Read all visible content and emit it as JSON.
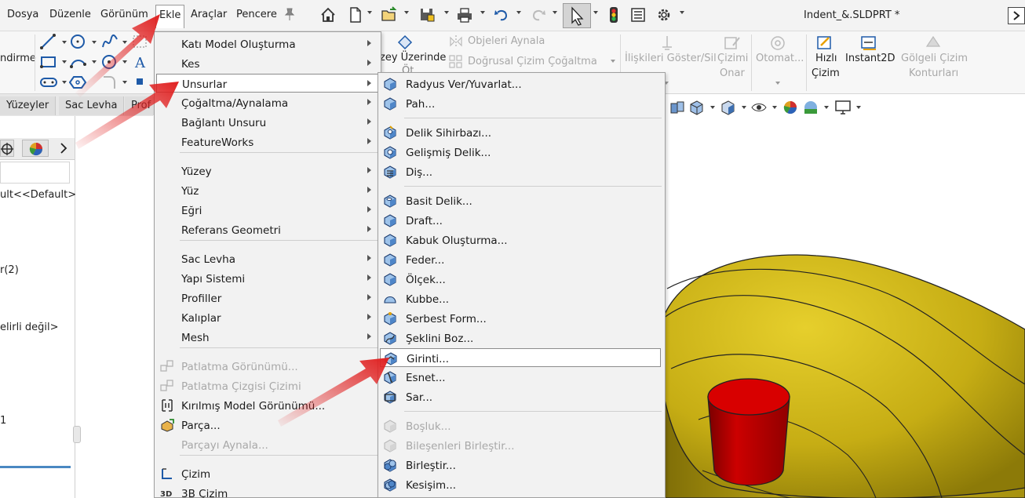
{
  "menubar": {
    "items": [
      "Dosya",
      "Düzenle",
      "Görünüm",
      "Ekle",
      "Araçlar",
      "Pencere"
    ],
    "active": "Ekle"
  },
  "document_title": "Indent_&.SLDPRT *",
  "ribbon": {
    "partial_left_label": "ndirme",
    "surface_label_top": "zey Üzerinde",
    "surface_label_bottom": "Öt",
    "mirror_objects": "Objeleri Aynala",
    "linear_pattern": "Doğrusal Çizim Çoğaltma",
    "show_relations": "İlişkileri Göster/Sil",
    "repair_sketch": [
      "Çizimi",
      "Onar"
    ],
    "auto": "Otomat...",
    "quick_sketch": [
      "Hızlı",
      "Çizim"
    ],
    "instant2d": "Instant2D",
    "shaded_contours": [
      "Gölgeli Çizim",
      "Konturları"
    ]
  },
  "tabs": [
    "Yüzeyler",
    "Sac Levha",
    "Prof"
  ],
  "left_panel": {
    "lines": [
      "ult<<Default>",
      "r(2)",
      "elirli değil>",
      "1"
    ]
  },
  "ekle_menu": {
    "items": [
      {
        "label": "Katı Model Oluşturma",
        "submenu": true,
        "disabled": false
      },
      {
        "label": "Kes",
        "submenu": true,
        "disabled": false
      },
      {
        "label": "Unsurlar",
        "submenu": true,
        "disabled": false,
        "highlighted": true
      },
      {
        "label": "Çoğaltma/Aynalama",
        "submenu": true,
        "disabled": false
      },
      {
        "label": "Bağlantı Unsuru",
        "submenu": true,
        "disabled": false
      },
      {
        "label": "FeatureWorks",
        "submenu": true,
        "disabled": false
      },
      {
        "label": "Yüzey",
        "submenu": true,
        "disabled": false
      },
      {
        "label": "Yüz",
        "submenu": true,
        "disabled": false
      },
      {
        "label": "Eğri",
        "submenu": true,
        "disabled": false
      },
      {
        "label": "Referans Geometri",
        "submenu": true,
        "disabled": false
      },
      {
        "label": "Sac Levha",
        "submenu": true,
        "disabled": false
      },
      {
        "label": "Yapı Sistemi",
        "submenu": true,
        "disabled": false
      },
      {
        "label": "Profiller",
        "submenu": true,
        "disabled": false
      },
      {
        "label": "Kalıplar",
        "submenu": true,
        "disabled": false
      },
      {
        "label": "Mesh",
        "submenu": true,
        "disabled": false
      },
      {
        "label": "Patlatma Görünümü...",
        "submenu": false,
        "disabled": true
      },
      {
        "label": "Patlatma Çizgisi Çizimi",
        "submenu": false,
        "disabled": true
      },
      {
        "label": "Kırılmış Model Görünümü...",
        "submenu": false,
        "disabled": false
      },
      {
        "label": "Parça...",
        "submenu": false,
        "disabled": false
      },
      {
        "label": "Parçayı Aynala...",
        "submenu": false,
        "disabled": true
      },
      {
        "label": "Çizim",
        "submenu": false,
        "disabled": false
      },
      {
        "label": "3B Çizim",
        "submenu": false,
        "disabled": false
      }
    ]
  },
  "unsurlar_menu": {
    "items": [
      {
        "label": "Radyus Ver/Yuvarlat...",
        "disabled": false,
        "icon": "fillet-icon"
      },
      {
        "label": "Pah...",
        "disabled": false,
        "icon": "chamfer-icon"
      },
      {
        "label": "Delik Sihirbazı...",
        "disabled": false,
        "icon": "hole-wizard-icon"
      },
      {
        "label": "Gelişmiş Delik...",
        "disabled": false,
        "icon": "advanced-hole-icon"
      },
      {
        "label": "Diş...",
        "disabled": false,
        "icon": "thread-icon"
      },
      {
        "label": "Basit Delik...",
        "disabled": false,
        "icon": "simple-hole-icon"
      },
      {
        "label": "Draft...",
        "disabled": false,
        "icon": "draft-icon"
      },
      {
        "label": "Kabuk Oluşturma...",
        "disabled": false,
        "icon": "shell-icon"
      },
      {
        "label": "Feder...",
        "disabled": false,
        "icon": "rib-icon"
      },
      {
        "label": "Ölçek...",
        "disabled": false,
        "icon": "scale-icon"
      },
      {
        "label": "Kubbe...",
        "disabled": false,
        "icon": "dome-icon"
      },
      {
        "label": "Serbest Form...",
        "disabled": false,
        "icon": "freeform-icon"
      },
      {
        "label": "Şeklini Boz...",
        "disabled": false,
        "icon": "deform-icon"
      },
      {
        "label": "Girinti...",
        "disabled": false,
        "icon": "indent-icon",
        "highlighted": true
      },
      {
        "label": "Esnet...",
        "disabled": false,
        "icon": "flex-icon"
      },
      {
        "label": "Sar...",
        "disabled": false,
        "icon": "wrap-icon"
      },
      {
        "label": "Boşluk...",
        "disabled": true,
        "icon": "cavity-icon"
      },
      {
        "label": "Bileşenleri Birleştir...",
        "disabled": true,
        "icon": "join-icon"
      },
      {
        "label": "Birleştir...",
        "disabled": false,
        "icon": "combine-icon"
      },
      {
        "label": "Kesişim...",
        "disabled": false,
        "icon": "intersect-icon"
      }
    ]
  },
  "colors": {
    "part_body": "#c9b115",
    "boss": "#cc0000",
    "arrow": "#e02020",
    "highlight_border": "#8c8c8c"
  }
}
